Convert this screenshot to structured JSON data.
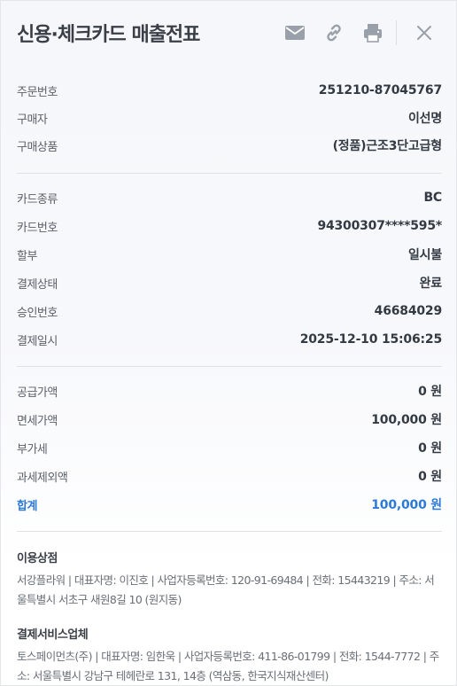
{
  "header": {
    "title": "신용·체크카드 매출전표",
    "icons": {
      "mail": "mail-icon",
      "link": "link-icon",
      "print": "printer-icon",
      "close": "close-icon"
    }
  },
  "order": {
    "rows": [
      {
        "label": "주문번호",
        "value": "251210-87045767"
      },
      {
        "label": "구매자",
        "value": "이선명"
      },
      {
        "label": "구매상품",
        "value": "(정품)근조3단고급형"
      }
    ]
  },
  "card": {
    "rows": [
      {
        "label": "카드종류",
        "value": "BC"
      },
      {
        "label": "카드번호",
        "value": "94300307****595*"
      },
      {
        "label": "할부",
        "value": "일시불"
      },
      {
        "label": "결제상태",
        "value": "완료"
      },
      {
        "label": "승인번호",
        "value": "46684029"
      },
      {
        "label": "결제일시",
        "value": "2025-12-10 15:06:25"
      }
    ]
  },
  "amount": {
    "rows": [
      {
        "label": "공급가액",
        "value": "0 원"
      },
      {
        "label": "면세가액",
        "value": "100,000 원"
      },
      {
        "label": "부가세",
        "value": "0 원"
      },
      {
        "label": "과세제외액",
        "value": "0 원"
      }
    ],
    "total": {
      "label": "합계",
      "value": "100,000 원"
    }
  },
  "merchant": {
    "title": "이용상점",
    "text": "서강플라워 | 대표자명: 이진호 | 사업자등록번호: 120-91-69484 | 전화: 15443219 | 주소: 서울특별시 서초구 새원8길 10 (원지동)"
  },
  "pg": {
    "title": "결제서비스업체",
    "text": "토스페이먼츠(주) | 대표자명: 임한욱 | 사업자등록번호: 411-86-01799 | 전화: 1544-7772 | 주소: 서울특별시 강남구 테헤란로 131, 14층 (역삼동, 한국지식재산센터)"
  },
  "colors": {
    "accent": "#2d7ad6",
    "icon": "#9aa0a9"
  }
}
